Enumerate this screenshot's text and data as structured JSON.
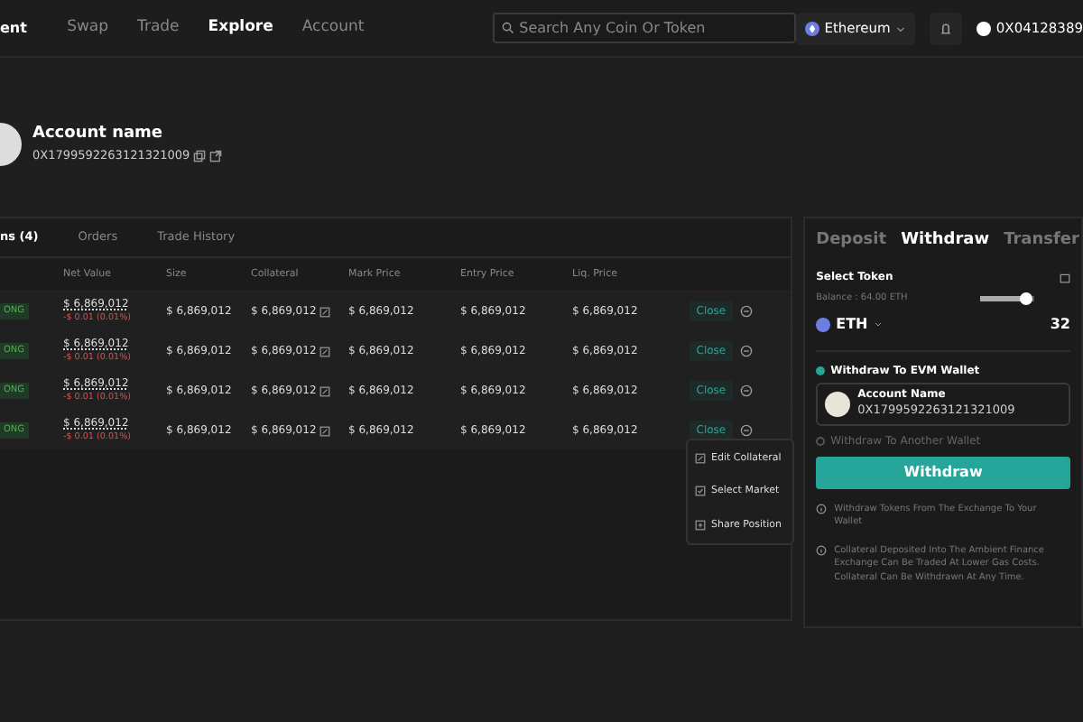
{
  "nav": {
    "logo": "ent",
    "links": [
      {
        "label": "Swap",
        "selected": false
      },
      {
        "label": "Trade",
        "selected": false
      },
      {
        "label": "Explore",
        "selected": true
      },
      {
        "label": "Account",
        "selected": false
      }
    ],
    "search": {
      "placeholder": "Search Any Coin Or Token"
    },
    "network": "Ethereum",
    "wallet": "0X04128389"
  },
  "account": {
    "name": "Account name",
    "address": "0X1799592263121321009"
  },
  "tabs": [
    {
      "label": "ns (4)",
      "selected": true
    },
    {
      "label": "Orders",
      "selected": false
    },
    {
      "label": "Trade History",
      "selected": false
    }
  ],
  "table": {
    "columns": [
      "Net Value",
      "Size",
      "Collateral",
      "Mark Price",
      "Entry Price",
      "Liq. Price"
    ],
    "rows": [
      {
        "side": "ONG",
        "net_value": "$ 6,869,012",
        "change": "-$ 0.01 (0.01%)",
        "size": "$ 6,869,012",
        "collateral": "$ 6,869,012",
        "mark_price": "$ 6,869,012",
        "entry_price": "$ 6,869,012",
        "liq_price": "$ 6,869,012",
        "action": "Close"
      },
      {
        "side": "ONG",
        "net_value": "$ 6,869,012",
        "change": "-$ 0.01 (0.01%)",
        "size": "$ 6,869,012",
        "collateral": "$ 6,869,012",
        "mark_price": "$ 6,869,012",
        "entry_price": "$ 6,869,012",
        "liq_price": "$ 6,869,012",
        "action": "Close"
      },
      {
        "side": "ONG",
        "net_value": "$ 6,869,012",
        "change": "-$ 0.01 (0.01%)",
        "size": "$ 6,869,012",
        "collateral": "$ 6,869,012",
        "mark_price": "$ 6,869,012",
        "entry_price": "$ 6,869,012",
        "liq_price": "$ 6,869,012",
        "action": "Close"
      },
      {
        "side": "ONG",
        "net_value": "$ 6,869,012",
        "change": "-$ 0.01 (0.01%)",
        "size": "$ 6,869,012",
        "collateral": "$ 6,869,012",
        "mark_price": "$ 6,869,012",
        "entry_price": "$ 6,869,012",
        "liq_price": "$ 6,869,012",
        "action": "Close"
      }
    ]
  },
  "menu": [
    {
      "kind": "edit",
      "label": "Edit Collateral"
    },
    {
      "kind": "select",
      "label": "Select Market"
    },
    {
      "kind": "share",
      "label": "Share Position"
    }
  ],
  "panel": {
    "tabs": [
      {
        "label": "Deposit",
        "selected": false
      },
      {
        "label": "Withdraw",
        "selected": true
      },
      {
        "label": "Transfer",
        "selected": false
      }
    ],
    "select_label": "Select Token",
    "balance": "Balance : 64.00 ETH",
    "level": 0.85,
    "token": "ETH",
    "amount": "32",
    "options": [
      {
        "label": "Withdraw To EVM Wallet",
        "selected": true
      },
      {
        "label": "Withdraw To Another Wallet",
        "selected": false
      }
    ],
    "wallet_name": "Account Name",
    "wallet_address": "0X1799592263121321009",
    "button": "Withdraw",
    "notes": [
      "Withdraw Tokens From The Exchange To Your Wallet",
      "Collateral Deposited Into The Ambient Finance Exchange Can Be Traded At Lower Gas Costs. Collateral Can Be Withdrawn At Any Time."
    ]
  }
}
